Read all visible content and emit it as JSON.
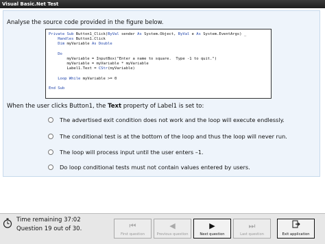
{
  "window": {
    "title": "Visual Basic.Net Test"
  },
  "question": {
    "prompt": "Analyse the source code provided in the figure below.",
    "code_lines": [
      [
        {
          "t": "Private Sub ",
          "k": true
        },
        {
          "t": "Button1_Click(",
          "k": false
        },
        {
          "t": "ByVal",
          "k": true
        },
        {
          "t": " sender ",
          "k": false
        },
        {
          "t": "As",
          "k": true
        },
        {
          "t": " System.Object, ",
          "k": false
        },
        {
          "t": "ByVal",
          "k": true
        },
        {
          "t": " e ",
          "k": false
        },
        {
          "t": "As",
          "k": true
        },
        {
          "t": " System.EventArgs) _",
          "k": false
        }
      ],
      [
        {
          "t": "    ",
          "k": false
        },
        {
          "t": "Handles",
          "k": true
        },
        {
          "t": " Button1.Click",
          "k": false
        }
      ],
      [
        {
          "t": "    ",
          "k": false
        },
        {
          "t": "Dim",
          "k": true
        },
        {
          "t": " myVariable ",
          "k": false
        },
        {
          "t": "As Double",
          "k": true
        }
      ],
      [],
      [
        {
          "t": "    ",
          "k": false
        },
        {
          "t": "Do",
          "k": true
        }
      ],
      [
        {
          "t": "        myVariable = InputBox(\"Enter a name to square.  Type -1 to quit.\")",
          "k": false
        }
      ],
      [
        {
          "t": "        myVariable = myVariable * myVariable",
          "k": false
        }
      ],
      [
        {
          "t": "        Label1.Text = ",
          "k": false
        },
        {
          "t": "CStr",
          "k": true
        },
        {
          "t": "(myVariable)",
          "k": false
        }
      ],
      [],
      [
        {
          "t": "    ",
          "k": false
        },
        {
          "t": "Loop While",
          "k": true
        },
        {
          "t": " myVariable >= 0",
          "k": false
        }
      ],
      [],
      [
        {
          "t": "End Sub",
          "k": true
        }
      ]
    ],
    "text_before": "When the user clicks Button1, the ",
    "text_bold": "Text",
    "text_after": " property of Label1 is set to:",
    "options": [
      "The advertised exit condition does not work and the loop will execute endlessly.",
      "The conditional test is at the bottom of the loop and thus the loop will never run.",
      "The loop will process input until the user enters –1.",
      "Do loop conditional tests must not contain values entered by users."
    ]
  },
  "status": {
    "time_remaining": "Time remaining 37:02",
    "question_count": "Question 19 out of 30."
  },
  "nav": {
    "first": {
      "label": "First question",
      "icon": "skip-back-icon",
      "enabled": false
    },
    "previous": {
      "label": "Previous question",
      "icon": "previous-icon",
      "enabled": false
    },
    "next": {
      "label": "Next question",
      "icon": "next-icon",
      "enabled": true
    },
    "last": {
      "label": "Last question",
      "icon": "skip-forward-icon",
      "enabled": false
    },
    "exit": {
      "label": "Exit application",
      "icon": "exit-icon",
      "enabled": true
    }
  }
}
